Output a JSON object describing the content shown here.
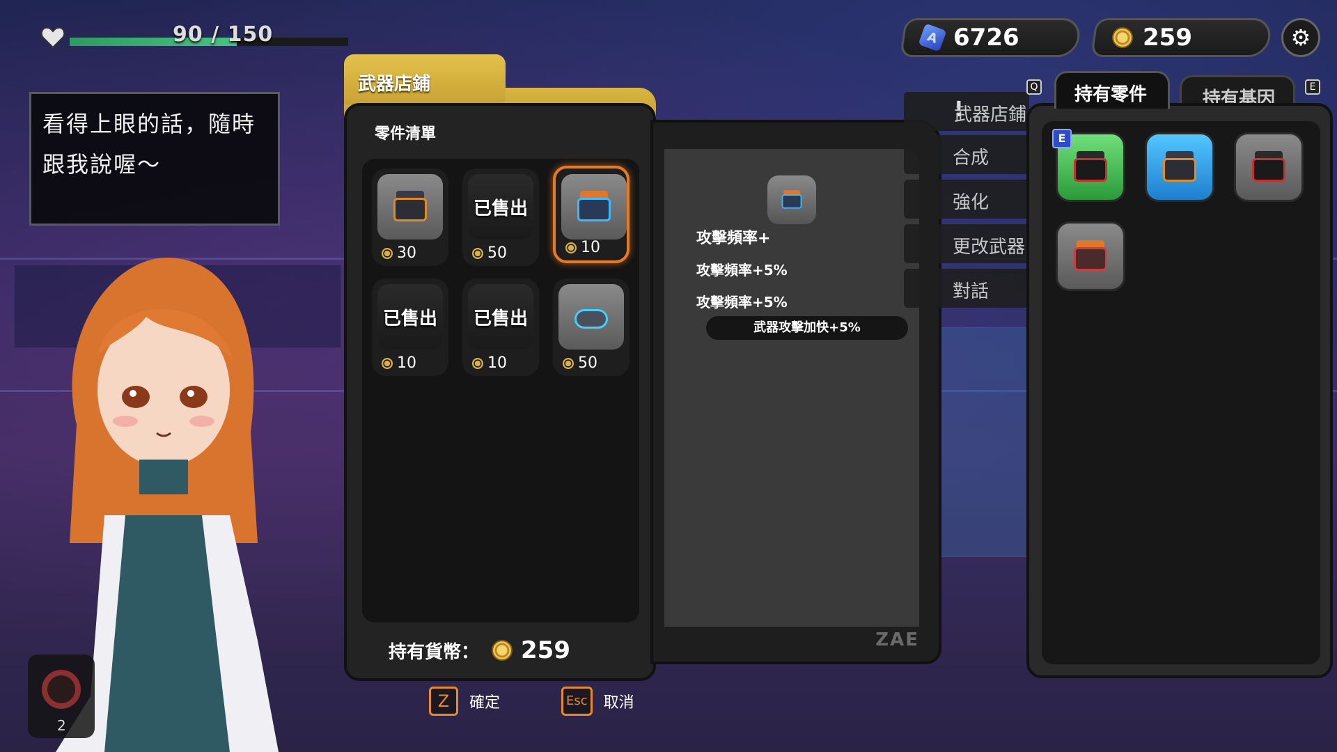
{
  "hp": {
    "text": "90 / 150",
    "fraction": 0.6
  },
  "top_counters": {
    "crystals": "6726",
    "coins": "259"
  },
  "dialog": {
    "line1": "看得上眼的話，隨時",
    "line2": "跟我說喔～"
  },
  "shop": {
    "tab_label": "武器店鋪",
    "list_title": "零件清單",
    "sold_label": "已售出",
    "items": [
      {
        "price": "30",
        "sold": false,
        "icon": "part-box-orange"
      },
      {
        "price": "50",
        "sold": true,
        "icon": "part-box-dark"
      },
      {
        "price": "10",
        "sold": false,
        "selected": true,
        "icon": "part-stack-orange-blue"
      },
      {
        "price": "10",
        "sold": true,
        "icon": "part-box-brown"
      },
      {
        "price": "10",
        "sold": true,
        "icon": "part-box-dark"
      },
      {
        "price": "50",
        "sold": false,
        "icon": "part-cylinder-cyan"
      }
    ],
    "currency_label": "持有貨幣：",
    "currency_value": "259"
  },
  "detail": {
    "title": "攻擊頻率+",
    "lines": [
      "攻擊頻率+5%",
      "攻擊頻率+5%"
    ],
    "effect": "武器攻擊加快+5%",
    "logo": "ZAE"
  },
  "menu": {
    "items": [
      "武器店鋪",
      "合成",
      "強化",
      "更改武器",
      "對話"
    ]
  },
  "right_panel": {
    "tab_parts": "持有零件",
    "tab_genes": "持有基因",
    "key_left": "Q",
    "key_right": "E",
    "equipped_badge": "E"
  },
  "inventory_slot": {
    "count": "2"
  },
  "hints": {
    "confirm_key": "Z",
    "confirm_label": "確定",
    "cancel_key": "Esc",
    "cancel_label": "取消"
  }
}
